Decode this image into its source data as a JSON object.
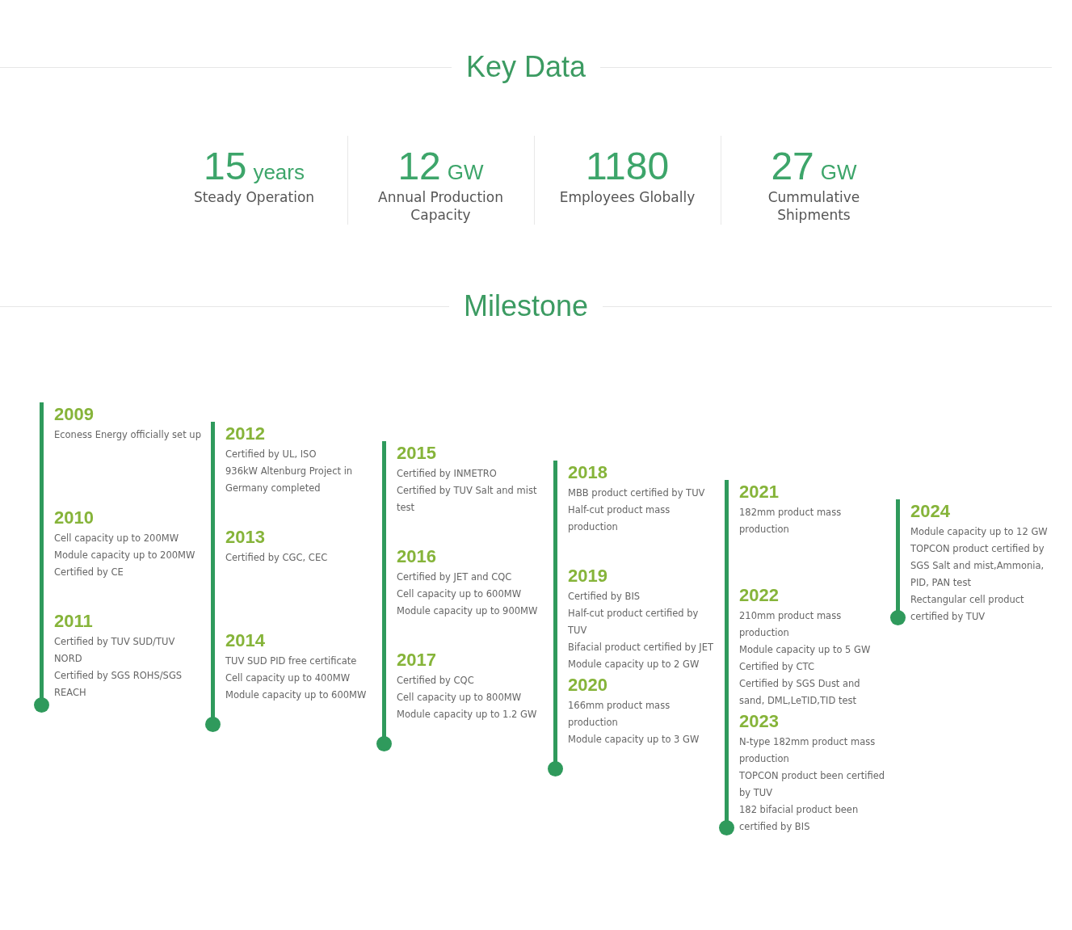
{
  "key_data": {
    "title": "Key Data",
    "stats": [
      {
        "value": "15",
        "unit": "years",
        "label": "Steady Operation"
      },
      {
        "value": "12",
        "unit": "GW",
        "label": "Annual Production Capacity"
      },
      {
        "value": "1180",
        "label": "Employees Globally"
      },
      {
        "value": "27",
        "unit": "GW",
        "label": "Cummulative Shipments"
      }
    ]
  },
  "milestone": {
    "title": "Milestone",
    "columns": [
      {
        "entries": [
          {
            "year": "2009",
            "lines": [
              "Econess Energy officially set up"
            ]
          },
          {
            "year": "2010",
            "lines": [
              "Cell capacity up to 200MW",
              "Module capacity up to 200MW",
              "Certified by CE"
            ]
          },
          {
            "year": "2011",
            "lines": [
              "Certified by TUV SUD/TUV NORD",
              "Certified by SGS ROHS/SGS REACH"
            ]
          }
        ]
      },
      {
        "entries": [
          {
            "year": "2012",
            "lines": [
              "Certified by UL, ISO",
              "936kW Altenburg Project in Germany completed"
            ]
          },
          {
            "year": "2013",
            "lines": [
              "Certified by CGC, CEC"
            ]
          },
          {
            "year": "2014",
            "lines": [
              "TUV SUD PID free certificate",
              "Cell capacity up to 400MW",
              "Module capacity up to 600MW"
            ]
          }
        ]
      },
      {
        "entries": [
          {
            "year": "2015",
            "lines": [
              "Certified by INMETRO",
              "Certified by TUV Salt and mist test"
            ]
          },
          {
            "year": "2016",
            "lines": [
              "Certified by JET and CQC",
              "Cell capacity up to 600MW",
              "Module capacity up to 900MW"
            ]
          },
          {
            "year": "2017",
            "lines": [
              "Certified by CQC",
              "Cell capacity up to 800MW",
              "Module capacity up to 1.2 GW"
            ]
          }
        ]
      },
      {
        "entries": [
          {
            "year": "2018",
            "lines": [
              "MBB product certified by TUV",
              "Half-cut product mass production"
            ]
          },
          {
            "year": "2019",
            "lines": [
              "Certified by BIS",
              "Half-cut product certified by TUV",
              "Bifacial product certified by JET",
              "Module capacity up to 2 GW"
            ]
          },
          {
            "year": "2020",
            "lines": [
              "166mm product mass production",
              "Module capacity up to 3 GW"
            ]
          }
        ]
      },
      {
        "entries": [
          {
            "year": "2021",
            "lines": [
              "182mm product mass production"
            ]
          },
          {
            "year": "2022",
            "lines": [
              "210mm product mass production",
              "Module capacity up to 5 GW",
              "Certified by CTC",
              "Certified by SGS Dust and sand, DML,LeTID,TID test"
            ]
          },
          {
            "year": "2023",
            "lines": [
              "N-type 182mm product mass production",
              "TOPCON product been certified by TUV",
              "182 bifacial product been certified by BIS"
            ]
          }
        ]
      },
      {
        "entries": [
          {
            "year": "2024",
            "lines": [
              "Module capacity up to 12 GW",
              "TOPCON product certified by SGS Salt and mist,Ammonia, PID, PAN test",
              "Rectangular cell product certified by TUV"
            ]
          }
        ]
      }
    ]
  }
}
